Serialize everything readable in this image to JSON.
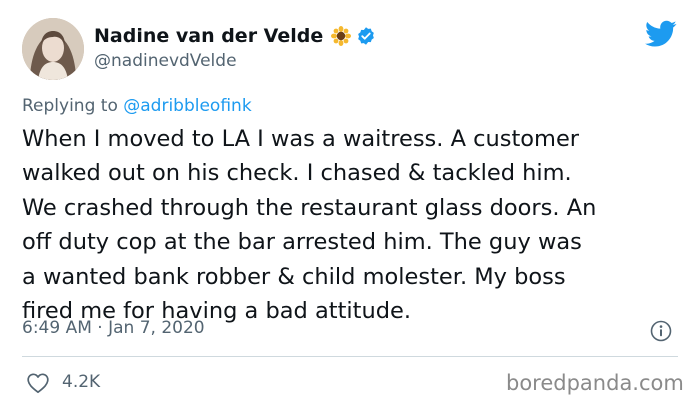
{
  "author": {
    "display_name": "Nadine van der Velde",
    "handle": "@nadinevdVelde",
    "badge_emoji": "sunflower-icon",
    "verified": true
  },
  "reply": {
    "prefix": "Replying to",
    "handle": "@adribbleofink"
  },
  "tweet": {
    "lines": [
      "When I moved to LA I was a waitress. A customer",
      "walked out on his check. I chased & tackled him.",
      "We crashed through the restaurant glass doors. An",
      "off duty cop at the bar arrested him. The guy was",
      "a wanted bank robber & child molester. My boss",
      "fired me for having a bad attitude."
    ],
    "timestamp": "6:49 AM · Jan 7, 2020"
  },
  "engagement": {
    "likes": "4.2K"
  },
  "watermark": "boredpanda.com",
  "colors": {
    "brand_blue": "#1d9bf0",
    "secondary_text": "#536471",
    "primary_text": "#0f1419",
    "divider": "#cfd9de"
  }
}
